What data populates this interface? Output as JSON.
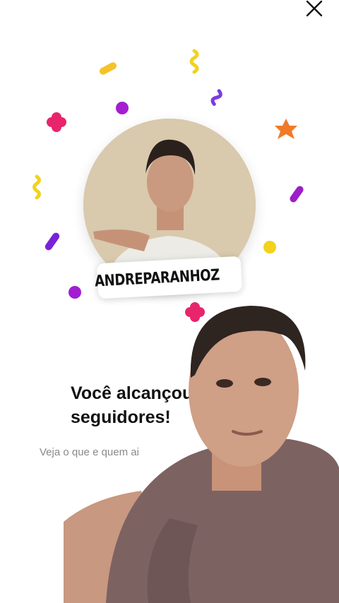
{
  "profile": {
    "handle": "ANDREPARANHOZ",
    "handle_icon": "threads-icon"
  },
  "milestone": {
    "title": "Você alcançou\nseguidores!",
    "subtitle": "Veja o que e quem ai"
  },
  "controls": {
    "close_icon": "close-icon"
  },
  "colors": {
    "background": "#ffffff",
    "confetti_pink": "#e8246c",
    "confetti_purple": "#9b1ec8",
    "confetti_yellow": "#f2d21c",
    "confetti_orange": "#f07a28"
  }
}
